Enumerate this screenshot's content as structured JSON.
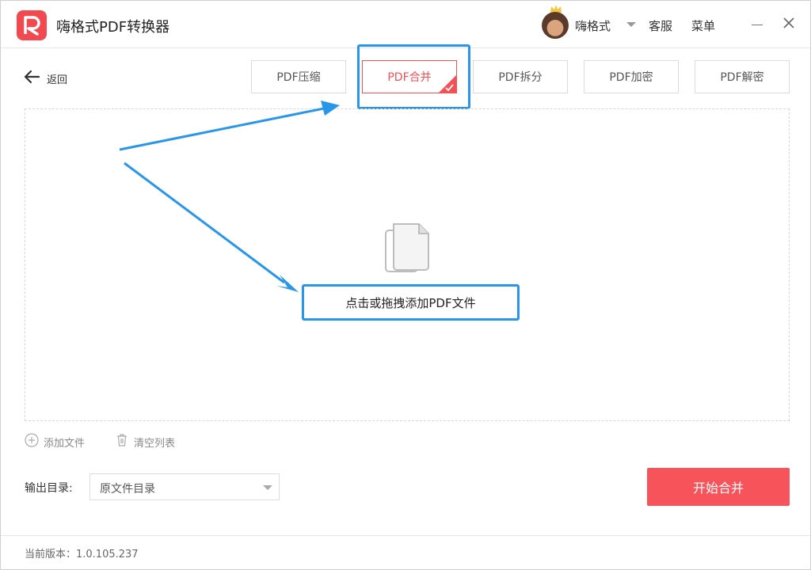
{
  "app": {
    "title": "嗨格式PDF转换器",
    "logo_icon": "pdf-logo-icon",
    "brand_color": "#f1494f"
  },
  "header": {
    "username": "嗨格式",
    "service_label": "客服",
    "menu_label": "菜单"
  },
  "nav": {
    "back_label": "返回"
  },
  "tabs": [
    {
      "label": "PDF压缩",
      "active": false
    },
    {
      "label": "PDF合并",
      "active": true
    },
    {
      "label": "PDF拆分",
      "active": false
    },
    {
      "label": "PDF加密",
      "active": false
    },
    {
      "label": "PDF解密",
      "active": false
    }
  ],
  "dropzone": {
    "text": "点击或拖拽添加PDF文件",
    "icon": "documents-icon"
  },
  "actions": {
    "add_file_label": "添加文件",
    "clear_list_label": "清空列表"
  },
  "output": {
    "label": "输出目录:",
    "selected": "原文件目录"
  },
  "start_button": {
    "label": "开始合并",
    "color": "#f7535a"
  },
  "footer": {
    "version_text": "当前版本：1.0.105.237"
  },
  "annotation_color": "#2a96ea"
}
